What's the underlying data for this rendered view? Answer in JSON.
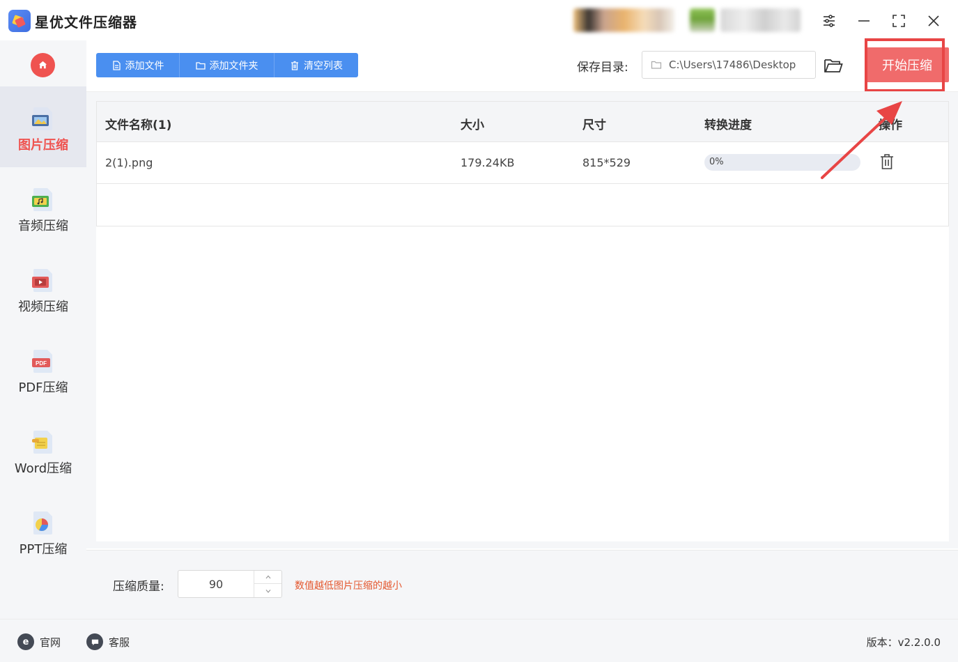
{
  "app": {
    "title": "星优文件压缩器"
  },
  "sidebar": {
    "items": [
      {
        "label": "图片压缩",
        "icon": "image-file-icon",
        "active": true
      },
      {
        "label": "音频压缩",
        "icon": "audio-file-icon",
        "active": false
      },
      {
        "label": "视频压缩",
        "icon": "video-file-icon",
        "active": false
      },
      {
        "label": "PDF压缩",
        "icon": "pdf-file-icon",
        "active": false
      },
      {
        "label": "Word压缩",
        "icon": "word-file-icon",
        "active": false
      },
      {
        "label": "PPT压缩",
        "icon": "ppt-file-icon",
        "active": false
      }
    ]
  },
  "toolbar": {
    "add_file": "添加文件",
    "add_folder": "添加文件夹",
    "clear_list": "清空列表",
    "save_label": "保存目录:",
    "save_path": "C:\\Users\\17486\\Desktop",
    "start_button": "开始压缩"
  },
  "table": {
    "headers": {
      "name": "文件名称(1)",
      "size": "大小",
      "dimension": "尺寸",
      "progress": "转换进度",
      "action": "操作"
    },
    "rows": [
      {
        "name": "2(1).png",
        "size": "179.24KB",
        "dimension": "815*529",
        "progress_text": "0%",
        "progress": 0
      }
    ]
  },
  "settings": {
    "quality_label": "压缩质量:",
    "quality_value": "90",
    "quality_hint": "数值越低图片压缩的越小"
  },
  "footer": {
    "website": "官网",
    "support": "客服",
    "version": "版本：v2.2.0.0"
  },
  "colors": {
    "accent_blue": "#4a8ff0",
    "accent_red": "#ef5350",
    "start_button": "#f06b6b",
    "hint_orange": "#e4572e"
  }
}
